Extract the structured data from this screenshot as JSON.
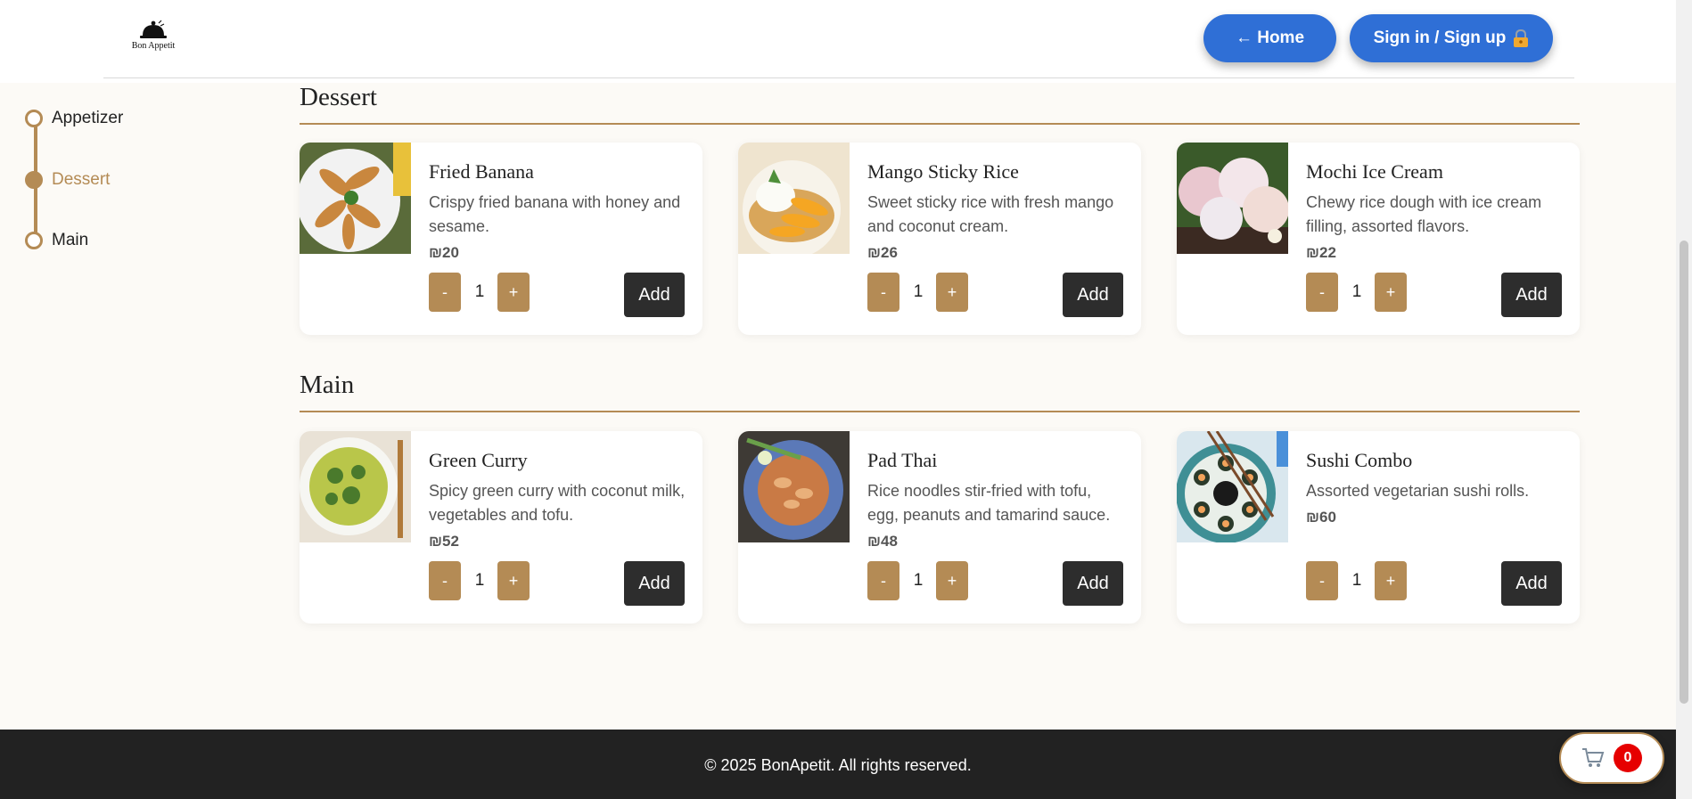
{
  "brand": {
    "logo_text": "Bon Appetit"
  },
  "header": {
    "home_label": "← Home",
    "sign_label": "Sign in / Sign up"
  },
  "sidebar": {
    "steps": [
      {
        "label": "Appetizer",
        "active": false
      },
      {
        "label": "Dessert",
        "active": true
      },
      {
        "label": "Main",
        "active": false
      }
    ]
  },
  "sections": [
    {
      "title": "Dessert",
      "items": [
        {
          "name": "Fried Banana",
          "desc": "Crispy fried banana with honey and sesame.",
          "price": "₪20",
          "qty": "1",
          "add": "Add",
          "minus": "-",
          "plus": "+"
        },
        {
          "name": "Mango Sticky Rice",
          "desc": "Sweet sticky rice with fresh mango and coconut cream.",
          "price": "₪26",
          "qty": "1",
          "add": "Add",
          "minus": "-",
          "plus": "+"
        },
        {
          "name": "Mochi Ice Cream",
          "desc": "Chewy rice dough with ice cream filling, assorted flavors.",
          "price": "₪22",
          "qty": "1",
          "add": "Add",
          "minus": "-",
          "plus": "+"
        }
      ]
    },
    {
      "title": "Main",
      "items": [
        {
          "name": "Green Curry",
          "desc": "Spicy green curry with coconut milk, vegetables and tofu.",
          "price": "₪52",
          "qty": "1",
          "add": "Add",
          "minus": "-",
          "plus": "+"
        },
        {
          "name": "Pad Thai",
          "desc": "Rice noodles stir-fried with tofu, egg, peanuts and tamarind sauce.",
          "price": "₪48",
          "qty": "1",
          "add": "Add",
          "minus": "-",
          "plus": "+"
        },
        {
          "name": "Sushi Combo",
          "desc": "Assorted vegetarian sushi rolls.",
          "price": "₪60",
          "qty": "1",
          "add": "Add",
          "minus": "-",
          "plus": "+"
        }
      ]
    }
  ],
  "footer": {
    "text": "© 2025 BonApetit. All rights reserved."
  },
  "cart": {
    "count": "0",
    "icon": "cart-icon"
  },
  "colors": {
    "accent": "#b48b55",
    "primary": "#2f6fd6",
    "dark": "#2d2d2d",
    "badge": "#e60000"
  }
}
